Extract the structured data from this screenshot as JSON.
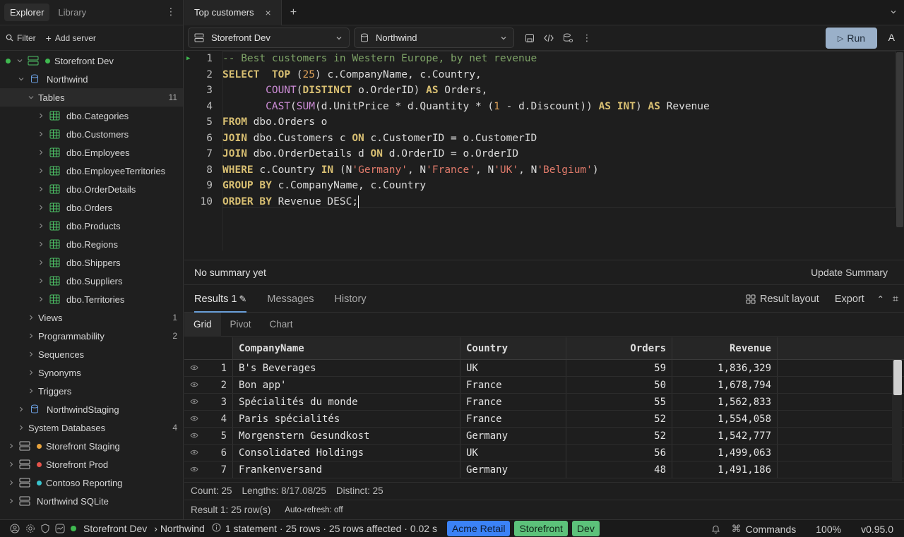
{
  "sidebar": {
    "tabs": [
      "Explorer",
      "Library"
    ],
    "tools": {
      "filter": "Filter",
      "add_server": "Add server"
    },
    "tree": [
      {
        "label": "Storefront Dev",
        "level": 0,
        "type": "server",
        "dot": "#3fb950",
        "conn": "#3fb950",
        "open": true
      },
      {
        "label": "Northwind",
        "level": 1,
        "type": "db",
        "open": true
      },
      {
        "label": "Tables",
        "level": 2,
        "type": "folder",
        "count": "11",
        "open": true,
        "selected": true
      },
      {
        "label": "dbo.Categories",
        "level": 3,
        "type": "table"
      },
      {
        "label": "dbo.Customers",
        "level": 3,
        "type": "table"
      },
      {
        "label": "dbo.Employees",
        "level": 3,
        "type": "table"
      },
      {
        "label": "dbo.EmployeeTerritories",
        "level": 3,
        "type": "table"
      },
      {
        "label": "dbo.OrderDetails",
        "level": 3,
        "type": "table"
      },
      {
        "label": "dbo.Orders",
        "level": 3,
        "type": "table"
      },
      {
        "label": "dbo.Products",
        "level": 3,
        "type": "table"
      },
      {
        "label": "dbo.Regions",
        "level": 3,
        "type": "table"
      },
      {
        "label": "dbo.Shippers",
        "level": 3,
        "type": "table"
      },
      {
        "label": "dbo.Suppliers",
        "level": 3,
        "type": "table"
      },
      {
        "label": "dbo.Territories",
        "level": 3,
        "type": "table"
      },
      {
        "label": "Views",
        "level": 2,
        "type": "folder",
        "count": "1"
      },
      {
        "label": "Programmability",
        "level": 2,
        "type": "folder",
        "count": "2"
      },
      {
        "label": "Sequences",
        "level": 2,
        "type": "folder"
      },
      {
        "label": "Synonyms",
        "level": 2,
        "type": "folder"
      },
      {
        "label": "Triggers",
        "level": 2,
        "type": "folder"
      },
      {
        "label": "NorthwindStaging",
        "level": 1,
        "type": "db"
      },
      {
        "label": "System Databases",
        "level": 1,
        "type": "folder",
        "count": "4"
      },
      {
        "label": "Storefront Staging",
        "level": 0,
        "type": "server",
        "dot": "#e8a33d"
      },
      {
        "label": "Storefront Prod",
        "level": 0,
        "type": "server",
        "dot": "#e5534b"
      },
      {
        "label": "Contoso Reporting",
        "level": 0,
        "type": "server",
        "dot": "#39c5cf"
      },
      {
        "label": "Northwind SQLite",
        "level": 0,
        "type": "server"
      }
    ]
  },
  "tab": {
    "title": "Top customers"
  },
  "toolbar": {
    "server": "Storefront Dev",
    "database": "Northwind",
    "run_label": "Run",
    "a_label": "A"
  },
  "editor": {
    "lines": [
      [
        [
          "cm",
          "-- Best customers in Western Europe, by net revenue"
        ]
      ],
      [
        [
          "kw",
          "SELECT"
        ],
        [
          "",
          "  "
        ],
        [
          "kw",
          "TOP"
        ],
        [
          "",
          " ("
        ],
        [
          "num",
          "25"
        ],
        [
          "",
          ") c.CompanyName, c.Country,"
        ]
      ],
      [
        [
          "",
          "       "
        ],
        [
          "fn",
          "COUNT"
        ],
        [
          "",
          "("
        ],
        [
          "kw",
          "DISTINCT"
        ],
        [
          "",
          " o.OrderID) "
        ],
        [
          "kw",
          "AS"
        ],
        [
          "",
          " Orders,"
        ]
      ],
      [
        [
          "",
          "       "
        ],
        [
          "fn",
          "CAST"
        ],
        [
          "",
          "("
        ],
        [
          "fn",
          "SUM"
        ],
        [
          "",
          "(d.UnitPrice * d.Quantity * ("
        ],
        [
          "num",
          "1"
        ],
        [
          "",
          " - d.Discount)) "
        ],
        [
          "kw",
          "AS"
        ],
        [
          "",
          " "
        ],
        [
          "kw",
          "INT"
        ],
        [
          "",
          ") "
        ],
        [
          "kw",
          "AS"
        ],
        [
          "",
          " Revenue"
        ]
      ],
      [
        [
          "kw",
          "FROM"
        ],
        [
          "",
          " dbo.Orders o"
        ]
      ],
      [
        [
          "kw",
          "JOIN"
        ],
        [
          "",
          " dbo.Customers c "
        ],
        [
          "kw",
          "ON"
        ],
        [
          "",
          " c.CustomerID = o.CustomerID"
        ]
      ],
      [
        [
          "kw",
          "JOIN"
        ],
        [
          "",
          " dbo.OrderDetails d "
        ],
        [
          "kw",
          "ON"
        ],
        [
          "",
          " d.OrderID = o.OrderID"
        ]
      ],
      [
        [
          "kw",
          "WHERE"
        ],
        [
          "",
          " c.Country "
        ],
        [
          "kw",
          "IN"
        ],
        [
          "",
          " (N"
        ],
        [
          "str",
          "'Germany'"
        ],
        [
          "",
          ", N"
        ],
        [
          "str",
          "'France'"
        ],
        [
          "",
          ", N"
        ],
        [
          "str",
          "'UK'"
        ],
        [
          "",
          ", N"
        ],
        [
          "str",
          "'Belgium'"
        ],
        [
          "",
          ")"
        ]
      ],
      [
        [
          "kw",
          "GROUP BY"
        ],
        [
          "",
          " c.CompanyName, c.Country"
        ]
      ],
      [
        [
          "kw",
          "ORDER BY"
        ],
        [
          "",
          " Revenue DESC;"
        ]
      ]
    ]
  },
  "summary": {
    "text": "No summary yet",
    "update": "Update Summary"
  },
  "results": {
    "tabs": [
      "Results 1",
      "Messages",
      "History"
    ],
    "result_layout": "Result layout",
    "export": "Export",
    "sub_tabs": [
      "Grid",
      "Pivot",
      "Chart"
    ],
    "columns": [
      "CompanyName",
      "Country",
      "Orders",
      "Revenue"
    ],
    "rows": [
      [
        "1",
        "B's Beverages",
        "UK",
        "59",
        "1,836,329"
      ],
      [
        "2",
        "Bon app'",
        "France",
        "50",
        "1,678,794"
      ],
      [
        "3",
        "Spécialités du monde",
        "France",
        "55",
        "1,562,833"
      ],
      [
        "4",
        "Paris spécialités",
        "France",
        "52",
        "1,554,058"
      ],
      [
        "5",
        "Morgenstern Gesundkost",
        "Germany",
        "52",
        "1,542,777"
      ],
      [
        "6",
        "Consolidated Holdings",
        "UK",
        "56",
        "1,499,063"
      ],
      [
        "7",
        "Frankenversand",
        "Germany",
        "48",
        "1,491,186"
      ]
    ],
    "stats": {
      "count": "Count: 25",
      "lengths": "Lengths: 8/17.08/25",
      "distinct": "Distinct: 25"
    },
    "result_info": "Result 1: 25 row(s)",
    "auto_refresh": "Auto-refresh: off"
  },
  "statusbar": {
    "connection": "Storefront Dev",
    "database": "› Northwind",
    "info": "1 statement · 25 rows · 25 rows affected · 0.02 s",
    "badges": [
      {
        "label": "Acme Retail",
        "bg": "#3b82f6",
        "fg": "#0d1b33"
      },
      {
        "label": "Storefront",
        "bg": "#5cc27a",
        "fg": "#0f2417"
      },
      {
        "label": "Dev",
        "bg": "#5cc27a",
        "fg": "#0f2417"
      }
    ],
    "commands": "Commands",
    "zoom": "100%",
    "version": "v0.95.0"
  }
}
